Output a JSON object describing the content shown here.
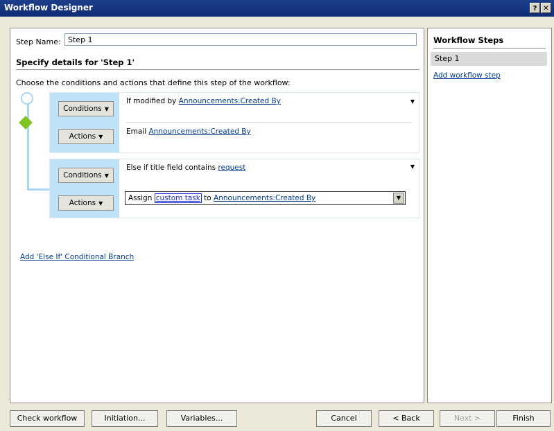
{
  "window": {
    "title": "Workflow Designer",
    "help_label": "?",
    "close_label": "✕"
  },
  "step": {
    "name_label": "Step Name:",
    "name_value": "Step 1",
    "details_title": "Specify details for 'Step 1'",
    "instructions": "Choose the conditions and actions that define this step of the workflow:"
  },
  "branches": [
    {
      "conditions_label": "Conditions",
      "actions_label": "Actions",
      "condition_prefix": "If modified by ",
      "condition_link": "Announcements:Created By",
      "action_prefix": "Email ",
      "action_link": "Announcements:Created By"
    },
    {
      "conditions_label": "Conditions",
      "actions_label": "Actions",
      "condition_prefix": "Else if title field contains ",
      "condition_link": "request",
      "action_prefix": "Assign ",
      "action_link_task": "custom task",
      "action_mid": " to ",
      "action_link": "Announcements:Created By"
    }
  ],
  "add_else_if": "Add 'Else If' Conditional Branch",
  "workflow_steps": {
    "title": "Workflow Steps",
    "items": [
      "Step 1"
    ],
    "add_label": "Add workflow step"
  },
  "buttons": {
    "check_workflow": "Check workflow",
    "initiation": "Initiation...",
    "variables": "Variables...",
    "cancel": "Cancel",
    "back": "< Back",
    "next": "Next >",
    "finish": "Finish"
  },
  "colors": {
    "title_bar": "#0e2b73",
    "branch_side": "#bfe2f7",
    "connector": "#a9d6f5",
    "diamond": "#7fc321",
    "link": "#003a8c",
    "selected_step": "#d9d9d9"
  }
}
